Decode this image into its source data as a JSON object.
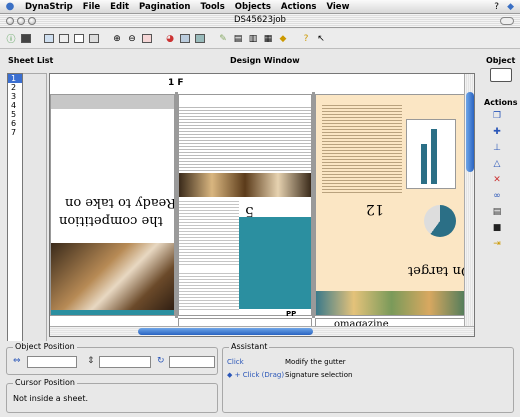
{
  "menubar": {
    "items": [
      "DynaStrip",
      "File",
      "Edit",
      "Pagination",
      "Tools",
      "Objects",
      "Actions",
      "View"
    ]
  },
  "window": {
    "title": "DS45623job"
  },
  "toolbar": {
    "buttons": [
      "info",
      "save",
      "new-sheet",
      "sheet",
      "pages",
      "copy",
      "zoom-in",
      "zoom-out",
      "zoom-fit",
      "color",
      "layers",
      "layout",
      "edit",
      "print",
      "press",
      "output",
      "tag",
      "help",
      "pointer"
    ]
  },
  "panels": {
    "sheet_list_label": "Sheet List",
    "design_window_label": "Design Window",
    "object_label": "Object",
    "actions_label": "Actions"
  },
  "sheets": [
    "1",
    "2",
    "3",
    "4",
    "5",
    "6",
    "7"
  ],
  "selected_sheet": "1",
  "design": {
    "sheet_label": "1 F",
    "page_label_bottom": "PP",
    "headline_left": "Ready to take on",
    "headline_left2": "the competition",
    "page_number_mid": "5",
    "page_number_right": "12",
    "headline_right": "On target",
    "masthead": "omagazine"
  },
  "object_position": {
    "label": "Object Position",
    "x_value": "",
    "y_value": "",
    "rotation_value": ""
  },
  "cursor_position": {
    "label": "Cursor Position",
    "value": "Not inside a sheet."
  },
  "assistant": {
    "label": "Assistant",
    "rows": [
      {
        "action": "Click",
        "description": "Modify the gutter"
      },
      {
        "action": "+ Click (Drag)",
        "description": "Signature selection"
      }
    ]
  },
  "colors": {
    "accent_blue": "#2a64c2",
    "teal": "#2b8fa0",
    "cream": "#fbe6c4"
  }
}
